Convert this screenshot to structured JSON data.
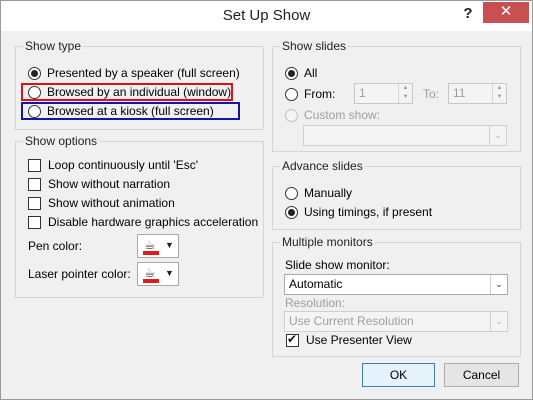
{
  "window": {
    "title": "Set Up Show",
    "help": "?",
    "close": "✕"
  },
  "show_type": {
    "title": "Show type",
    "options": [
      {
        "label": "Presented by a speaker (full screen)",
        "checked": true
      },
      {
        "label": "Browsed by an individual (window)",
        "checked": false
      },
      {
        "label": "Browsed at a kiosk (full screen)",
        "checked": false
      }
    ]
  },
  "show_options": {
    "title": "Show options",
    "checkboxes": [
      {
        "label": "Loop continuously until 'Esc'",
        "checked": false
      },
      {
        "label": "Show without narration",
        "checked": false
      },
      {
        "label": "Show without animation",
        "checked": false
      },
      {
        "label": "Disable hardware graphics acceleration",
        "checked": false
      }
    ],
    "pen_color_label": "Pen color:",
    "laser_color_label": "Laser pointer color:",
    "pen_color": "#e21a1a",
    "laser_color": "#e21a1a"
  },
  "show_slides": {
    "title": "Show slides",
    "all_label": "All",
    "from_label": "From:",
    "from_value": "1",
    "to_label": "To:",
    "to_value": "11",
    "custom_label": "Custom show:",
    "custom_value": ""
  },
  "advance_slides": {
    "title": "Advance slides",
    "manually_label": "Manually",
    "timings_label": "Using timings, if present"
  },
  "monitors": {
    "title": "Multiple monitors",
    "monitor_label": "Slide show monitor:",
    "monitor_value": "Automatic",
    "resolution_label": "Resolution:",
    "resolution_value": "Use Current Resolution",
    "presenter_label": "Use Presenter View",
    "presenter_checked": true
  },
  "buttons": {
    "ok": "OK",
    "cancel": "Cancel"
  },
  "colors": {
    "highlight_red": "#e0101a",
    "highlight_blue": "#1614a8",
    "close_bg": "#c75050"
  }
}
